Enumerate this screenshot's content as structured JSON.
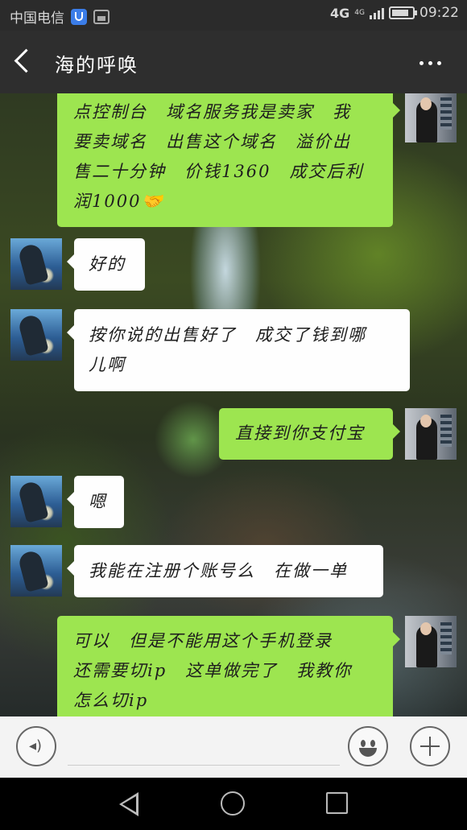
{
  "status_bar": {
    "carrier": "中国电信",
    "network": "4G",
    "network_secondary": "4G",
    "battery_level": 0.85,
    "time": "09:22"
  },
  "header": {
    "title": "海的呼唤",
    "back_icon": "chevron-left-icon",
    "more_icon": "more-horizontal-icon"
  },
  "messages": [
    {
      "side": "right",
      "lines": [
        "点控制台　域名服务我是卖家　我",
        "要卖域名　出售这个域名　溢价出",
        "售二十分钟　价钱1360　成交后利",
        "润1000🤝"
      ]
    },
    {
      "side": "left",
      "lines": [
        "好的"
      ]
    },
    {
      "side": "left",
      "lines": [
        "按你说的出售好了　成交了钱到哪",
        "儿啊"
      ]
    },
    {
      "side": "right",
      "lines": [
        "直接到你支付宝"
      ]
    },
    {
      "side": "left",
      "lines": [
        "嗯"
      ]
    },
    {
      "side": "left",
      "lines": [
        "我能在注册个账号么　在做一单"
      ]
    },
    {
      "side": "right",
      "lines": [
        "可以　但是不能用这个手机登录",
        "还需要切ip　这单做完了　我教你",
        "怎么切ip"
      ]
    }
  ],
  "input_bar": {
    "placeholder": "",
    "voice_icon": "voice-icon",
    "emoji_icon": "emoji-icon",
    "plus_icon": "plus-icon"
  },
  "nav_bar": {
    "back_icon": "nav-back-icon",
    "home_icon": "nav-home-icon",
    "recent_icon": "nav-recent-icon"
  },
  "colors": {
    "outgoing_bubble": "#9de550",
    "incoming_bubble": "#fefefe",
    "title_bar": "#2e2e2e"
  }
}
